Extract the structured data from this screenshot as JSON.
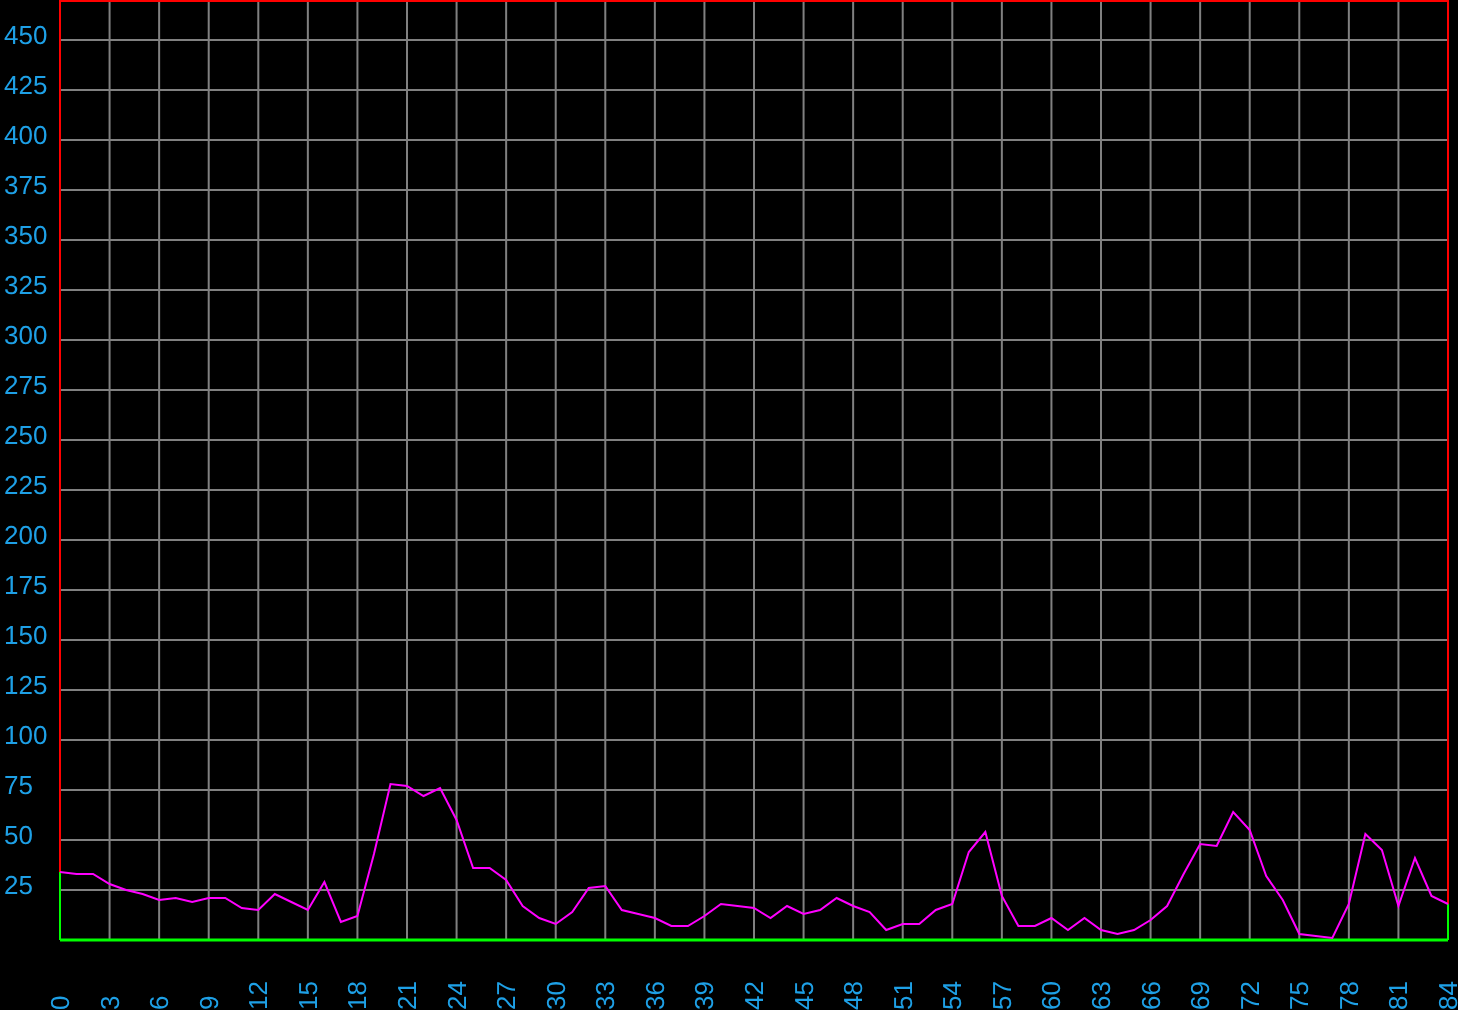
{
  "chart_data": {
    "type": "line",
    "x": [
      0,
      1,
      2,
      3,
      4,
      5,
      6,
      7,
      8,
      9,
      10,
      11,
      12,
      13,
      14,
      15,
      16,
      17,
      18,
      19,
      20,
      21,
      22,
      23,
      24,
      25,
      26,
      27,
      28,
      29,
      30,
      31,
      32,
      33,
      34,
      35,
      36,
      37,
      38,
      39,
      40,
      41,
      42,
      43,
      44,
      45,
      46,
      47,
      48,
      49,
      50,
      51,
      52,
      53,
      54,
      55,
      56,
      57,
      58,
      59,
      60,
      61,
      62,
      63,
      64,
      65,
      66,
      67,
      68,
      69,
      70,
      71,
      72,
      73,
      74,
      75,
      76,
      77,
      78,
      79,
      80,
      81,
      82,
      83,
      84
    ],
    "grid": true,
    "series": [
      {
        "color": "#ff00ff",
        "values": [
          34,
          33,
          33,
          28,
          25,
          23,
          20,
          21,
          19,
          21,
          21,
          16,
          15,
          23,
          19,
          15,
          29,
          9,
          12,
          43,
          78,
          77,
          72,
          76,
          60,
          36,
          36,
          30,
          17,
          11,
          8,
          14,
          26,
          27,
          15,
          13,
          11,
          7,
          7,
          12,
          18,
          17,
          16,
          11,
          17,
          13,
          15,
          21,
          17,
          14,
          5,
          8,
          8,
          15,
          18,
          44,
          54,
          22,
          7,
          7,
          11,
          5,
          11,
          5,
          3,
          5,
          10,
          17,
          33,
          48,
          47,
          64,
          55,
          32,
          20,
          3,
          2,
          1,
          18,
          53,
          45,
          17,
          41,
          22,
          18
        ]
      }
    ],
    "xlim": [
      0,
      84
    ],
    "ylim": [
      0,
      470
    ],
    "xticks": [
      0,
      3,
      6,
      9,
      12,
      15,
      18,
      21,
      24,
      27,
      30,
      33,
      36,
      39,
      42,
      45,
      48,
      51,
      54,
      57,
      60,
      63,
      66,
      69,
      72,
      75,
      78,
      81,
      84
    ],
    "yticks": [
      25,
      50,
      75,
      100,
      125,
      150,
      175,
      200,
      225,
      250,
      275,
      300,
      325,
      350,
      375,
      400,
      425,
      450
    ]
  }
}
